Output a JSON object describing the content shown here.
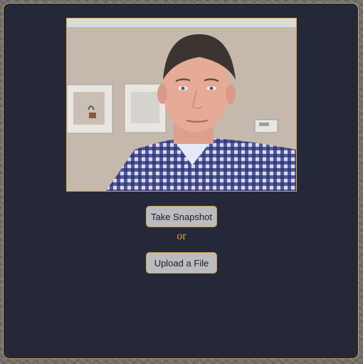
{
  "camera": {
    "feed": "webcam-preview"
  },
  "actions": {
    "snapshot_label": "Take Snapshot",
    "separator": "or",
    "upload_label": "Upload a File"
  },
  "colors": {
    "panel_background": "#252838",
    "accent_border": "#c9a34a",
    "separator_text": "#d6a23c",
    "button_background": "#bcbbc0"
  }
}
